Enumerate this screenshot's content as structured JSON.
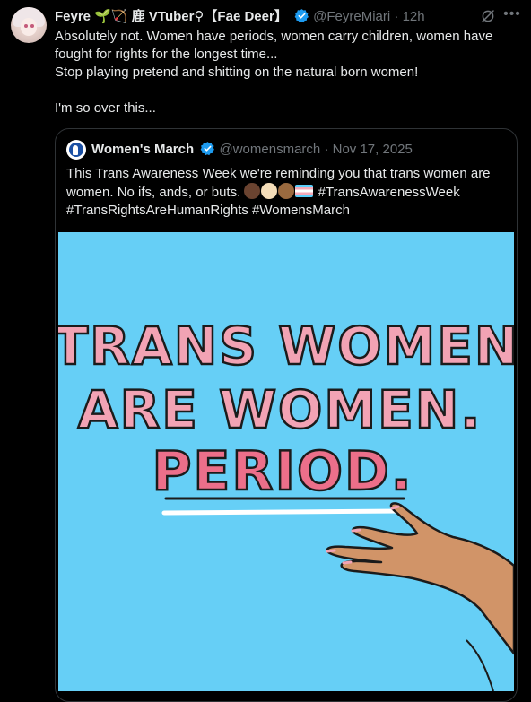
{
  "tweet": {
    "author_name": "Feyre",
    "author_deco": "🌱🏹 鹿 VTuber⚲【Fae Deer】",
    "handle": "@FeyreMiari",
    "separator": "·",
    "time": "12h",
    "lines": [
      "Absolutely not. Women have periods, women carry children, women have fought for rights for the longest time...",
      "Stop playing pretend and shitting on the natural born women!",
      "I'm so over this..."
    ]
  },
  "quote": {
    "author_name": "Women's March",
    "handle": "@womensmarch",
    "separator": "·",
    "date": "Nov 17, 2025",
    "text_start": "This Trans Awareness Week we're reminding you that trans women are women. No ifs, ands, or buts.",
    "hashtags": "#TransAwarenessWeek #TransRightsAreHumanRights #WomensMarch",
    "image_text": {
      "line1": "TRANS WOMEN",
      "line2": "ARE WOMEN.",
      "line3": "PERIOD."
    }
  },
  "colors": {
    "background": "#000000",
    "text": "#e7e9ea",
    "muted": "#71767b",
    "verified": "#1d9bf0",
    "image_bg": "#66cff6",
    "letter_fill": "#f2a3b4",
    "period_fill": "#ec6f8a"
  },
  "icons": {
    "verified": "verified-badge-icon",
    "grok": "grok-icon",
    "more": "more-dots-icon"
  }
}
